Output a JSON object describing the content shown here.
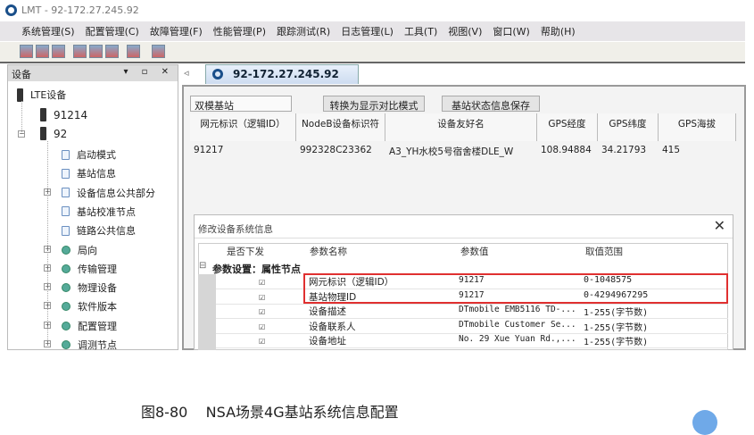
{
  "window": {
    "title": "LMT - 92-172.27.245.92"
  },
  "menu": [
    "系统管理(S)",
    "配置管理(C)",
    "故障管理(F)",
    "性能管理(P)",
    "跟踪测试(R)",
    "日志管理(L)",
    "工具(T)",
    "视图(V)",
    "窗口(W)",
    "帮助(H)"
  ],
  "left_panel": {
    "title": "设备",
    "controls": "▾ ▫ ✕",
    "tree": {
      "root": "LTE设备",
      "nodes": [
        "91214",
        "92"
      ],
      "children": [
        {
          "label": "启动模式",
          "type": "file",
          "expandable": false
        },
        {
          "label": "基站信息",
          "type": "file",
          "expandable": false
        },
        {
          "label": "设备信息公共部分",
          "type": "file",
          "expandable": true
        },
        {
          "label": "基站校准节点",
          "type": "file",
          "expandable": false
        },
        {
          "label": "链路公共信息",
          "type": "file",
          "expandable": false
        },
        {
          "label": "局向",
          "type": "green",
          "expandable": true
        },
        {
          "label": "传输管理",
          "type": "green",
          "expandable": true
        },
        {
          "label": "物理设备",
          "type": "green",
          "expandable": true
        },
        {
          "label": "软件版本",
          "type": "green",
          "expandable": true
        },
        {
          "label": "配置管理",
          "type": "green",
          "expandable": true
        },
        {
          "label": "调测节点",
          "type": "green",
          "expandable": true
        }
      ]
    }
  },
  "tab": {
    "label": "92-172.27.245.92",
    "scroll_left": "◃"
  },
  "main": {
    "mode_input": "双模基站",
    "btn_compare": "转换为显示对比模式",
    "btn_save": "基站状态信息保存",
    "columns": [
      "网元标识（逻辑ID）",
      "NodeB设备标识符",
      "设备友好名",
      "GPS经度",
      "GPS纬度",
      "GPS海拔"
    ],
    "row": [
      "91217",
      "992328C23362",
      "A3_YH水校5号宿舍楼DLE_W",
      "108.94884",
      "34.21793",
      "415"
    ]
  },
  "dialog": {
    "title": "修改设备系统信息",
    "close": "✕",
    "columns": [
      "是否下发",
      "参数名称",
      "参数值",
      "取值范围"
    ],
    "group": "参数设置：属性节点",
    "group_toggle": "⊟",
    "rows": [
      {
        "checked": "☑",
        "name": "网元标识（逻辑ID）",
        "value": "91217",
        "range": "0-1048575"
      },
      {
        "checked": "☑",
        "name": "基站物理ID",
        "value": "91217",
        "range": "0-4294967295"
      },
      {
        "checked": "☑",
        "name": "设备描述",
        "value": "DTmobile EMB5116 TD-...",
        "range": "1-255(字节数)"
      },
      {
        "checked": "☑",
        "name": "设备联系人",
        "value": "DTmobile Customer Se...",
        "range": "1-255(字节数)"
      },
      {
        "checked": "☑",
        "name": "设备地址",
        "value": "No. 29 Xue Yuan Rd.,...",
        "range": "1-255(字节数)"
      }
    ]
  },
  "caption": "图8-80    NSA场景4G基站系统信息配置",
  "colors": {
    "highlight": "#e03030",
    "brand": "#1a4f8a"
  }
}
